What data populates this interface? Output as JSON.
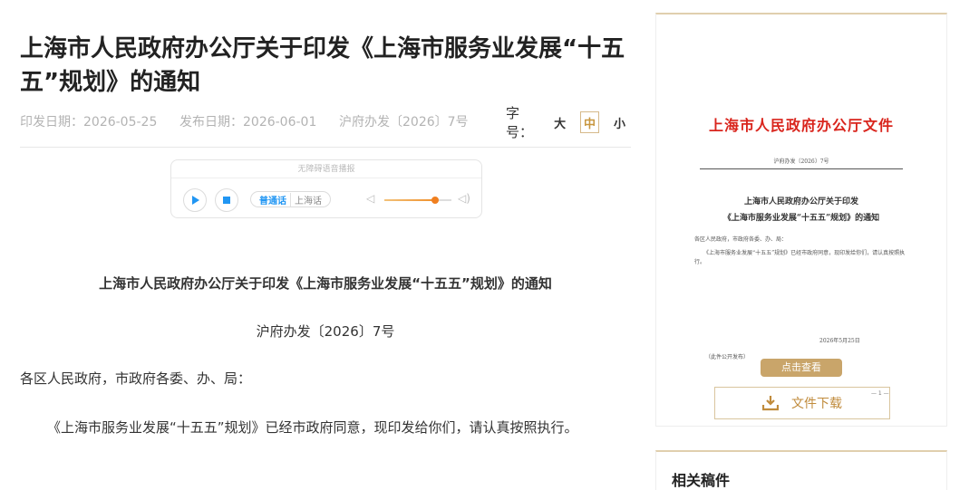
{
  "article": {
    "title": "上海市人民政府办公厅关于印发《上海市服务业发展“十五五”规划》的通知",
    "print_date_label": "印发日期：",
    "print_date": "2026-05-25",
    "publish_date_label": "发布日期：",
    "publish_date": "2026-06-01",
    "doc_number": "沪府办发〔2026〕7号",
    "font_size_label": "字号：",
    "font_size_options": [
      "大",
      "中",
      "小"
    ],
    "font_size_selected": "中"
  },
  "player": {
    "title": "无障碍语音播报",
    "languages": [
      "普通话",
      "上海话"
    ],
    "selected_language": "普通话",
    "volume": 0.75
  },
  "body": {
    "heading": "上海市人民政府办公厅关于印发《上海市服务业发展“十五五”规划》的通知",
    "doc_number": "沪府办发〔2026〕7号",
    "salutation": "各区人民政府，市政府各委、办、局：",
    "paragraph": "《上海市服务业发展“十五五”规划》已经市政府同意，现印发给你们，请认真按照执行。"
  },
  "preview": {
    "header": "上海市人民政府办公厅文件",
    "doc_number": "沪府办发〔2026〕7号",
    "title_line1": "上海市人民政府办公厅关于印发",
    "title_line2": "《上海市服务业发展“十五五”规划》的通知",
    "salutation": "各区人民政府，市政府各委、办、局：",
    "paragraph": "《上海市服务业发展“十五五”规划》已经市政府同意，现印发给你们，请认真按照执行。",
    "date": "2026年5月25日",
    "publish_note": "（此件公开发布）",
    "page_number": "— 1 —",
    "view_button": "点击查看",
    "download_button": "文件下载"
  },
  "related": {
    "title": "相关稿件"
  },
  "colors": {
    "accent_gold": "#c9a56a",
    "player_blue": "#2196f3",
    "red_header": "#d9251d"
  }
}
